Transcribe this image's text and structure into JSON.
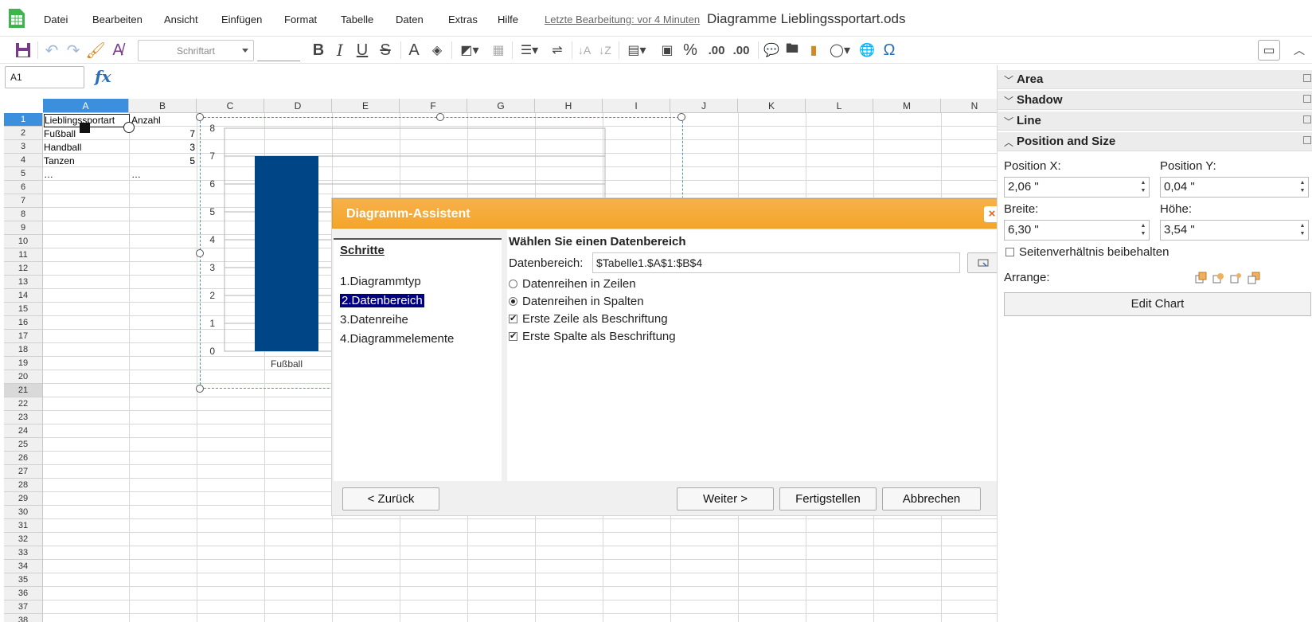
{
  "menubar": {
    "items": [
      "Datei",
      "Bearbeiten",
      "Ansicht",
      "Einfügen",
      "Format",
      "Tabelle",
      "Daten",
      "Extras",
      "Hilfe"
    ],
    "last_edit": "Letzte Bearbeitung: vor 4 Minuten",
    "doc_title": "Diagramme Lieblingssportart.ods"
  },
  "toolbar": {
    "font_placeholder": "Schriftart",
    "bold": "B",
    "italic": "I",
    "underline": "U",
    "strike": "S",
    "percent": "%",
    "decimal_remove": ".00",
    "decimal_add": ".00",
    "omega": "Ω"
  },
  "formula": {
    "namebox": "A1",
    "fx": "fx"
  },
  "sheet": {
    "columns": [
      "A",
      "B",
      "C",
      "D",
      "E",
      "F",
      "G",
      "H",
      "I",
      "J",
      "K",
      "L",
      "M",
      "N"
    ],
    "rows": [
      "1",
      "2",
      "3",
      "4",
      "5",
      "6",
      "7",
      "8",
      "9",
      "10",
      "11",
      "12",
      "13",
      "14",
      "15",
      "16",
      "17",
      "18",
      "19",
      "20",
      "21",
      "22",
      "23",
      "24",
      "25",
      "26",
      "27",
      "28",
      "29",
      "30",
      "31",
      "32",
      "33",
      "34",
      "35",
      "36",
      "37",
      "38"
    ],
    "cells": {
      "a1": "Lieblingssportart",
      "b1": "Anzahl",
      "a2": "Fußball",
      "b2": "7",
      "a3": "Handball",
      "b3": "3",
      "a4": "Tanzen",
      "b4": "5",
      "a5": "…",
      "b5": "…"
    }
  },
  "chart_data": {
    "type": "bar",
    "categories": [
      "Fußball"
    ],
    "values": [
      7
    ],
    "ylim": [
      0,
      8
    ],
    "yticks": [
      "0",
      "1",
      "2",
      "3",
      "4",
      "5",
      "6",
      "7",
      "8"
    ],
    "bar_color": "#004586",
    "grid": true
  },
  "dialog": {
    "title": "Diagramm-Assistent",
    "close": "×",
    "steps_title": "Schritte",
    "steps": [
      "1.Diagrammtyp",
      "2.Datenbereich",
      "3.Datenreihe",
      "4.Diagrammelemente"
    ],
    "content_title": "Wählen Sie einen Datenbereich",
    "range_label": "Datenbereich:",
    "range_value": "$Tabelle1.$A$1:$B$4",
    "options": {
      "rows": "Datenreihen in Zeilen",
      "cols": "Datenreihen in Spalten",
      "first_row": "Erste Zeile als Beschriftung",
      "first_col": "Erste Spalte als Beschriftung"
    },
    "buttons": {
      "back": "< Zurück",
      "next": "Weiter >",
      "finish": "Fertigstellen",
      "cancel": "Abbrechen"
    }
  },
  "sidebar": {
    "sections": [
      "Area",
      "Shadow",
      "Line",
      "Position and Size"
    ],
    "pos_x_label": "Position X:",
    "pos_y_label": "Position Y:",
    "pos_x": "2,06 \"",
    "pos_y": "0,04 \"",
    "width_label": "Breite:",
    "height_label": "Höhe:",
    "width": "6,30 \"",
    "height": "3,54 \"",
    "keep_ratio": "Seitenverhältnis beibehalten",
    "arrange_label": "Arrange:",
    "edit_chart": "Edit Chart"
  },
  "colors": {
    "accent": "#3c8fdd",
    "dialog_title": "#f5a52a",
    "chart_bar": "#004586"
  }
}
